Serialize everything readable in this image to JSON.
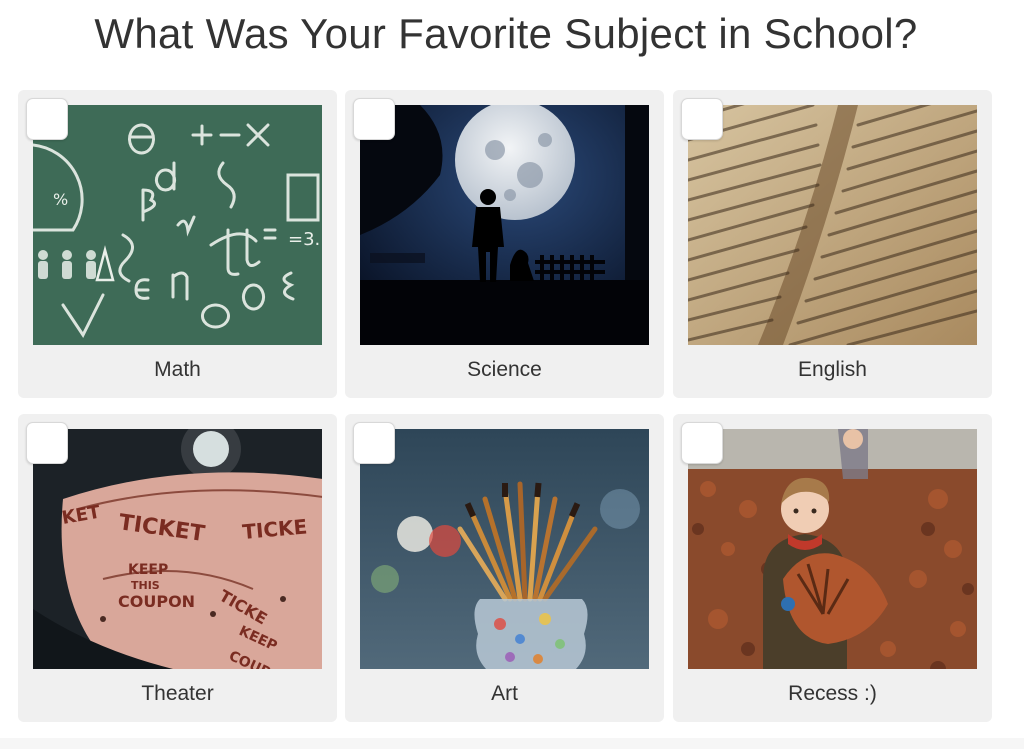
{
  "survey": {
    "question": "What Was Your Favorite Subject in School?"
  },
  "options": [
    {
      "label": "Math",
      "checked": false,
      "image": "chalkboard-math-symbols"
    },
    {
      "label": "Science",
      "checked": false,
      "image": "full-moon-silhouette"
    },
    {
      "label": "English",
      "checked": false,
      "image": "old-book-pages"
    },
    {
      "label": "Theater",
      "checked": false,
      "image": "ticket-roll"
    },
    {
      "label": "Art",
      "checked": false,
      "image": "paintbrushes-in-jar"
    },
    {
      "label": "Recess :)",
      "checked": false,
      "image": "child-with-autumn-leaves"
    }
  ],
  "colors": {
    "card_background": "#f0f0f0",
    "text": "#333333",
    "chalkboard": "#3e6b57"
  }
}
